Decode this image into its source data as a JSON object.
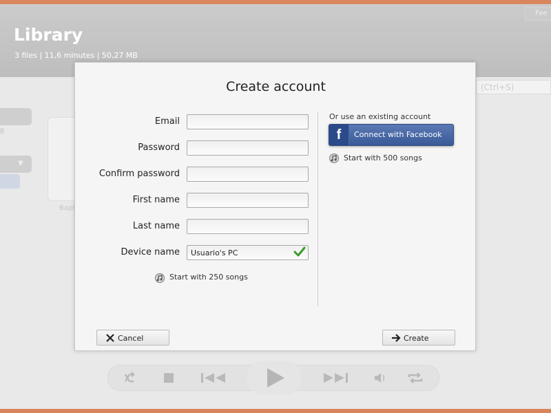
{
  "app": {
    "title": "Library",
    "subtitle": "3 files | 11,6 minutes | 50,27 MB",
    "top_right_button": "Fee",
    "search_placeholder": "(Ctrl+S)",
    "album_label": "Bapt",
    "colors": {
      "frame": "#d9865f",
      "header": "#b5b5b5"
    }
  },
  "player": {
    "icons": [
      "shuffle-icon",
      "stop-icon",
      "previous-icon",
      "play-icon",
      "next-icon",
      "volume-icon",
      "repeat-icon"
    ]
  },
  "dialog": {
    "title": "Create account",
    "fields": [
      {
        "label": "Email",
        "value": "",
        "placeholder": ""
      },
      {
        "label": "Password",
        "value": "",
        "placeholder": ""
      },
      {
        "label": "Confirm password",
        "value": "",
        "placeholder": ""
      },
      {
        "label": "First name",
        "value": "",
        "placeholder": ""
      },
      {
        "label": "Last name",
        "value": "",
        "placeholder": ""
      },
      {
        "label": "Device name",
        "value": "Usuario's PC",
        "placeholder": ""
      }
    ],
    "start_250": "Start with 250 songs",
    "or_use": "Or use an existing account",
    "facebook_button": "Connect with Facebook",
    "facebook_icon": "f",
    "start_500": "Start with 500 songs",
    "cancel_button": "Cancel",
    "create_button": "Create",
    "colors": {
      "facebook": "#3b5998",
      "check": "#3a9a2a"
    }
  }
}
